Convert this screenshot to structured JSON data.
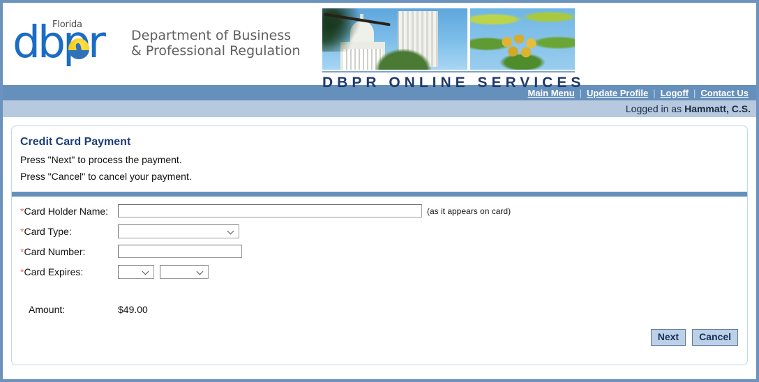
{
  "masthead": {
    "logo": {
      "florida": "Florida",
      "wordmark": "dbpr",
      "department": "Department of Business\n& Professional Regulation",
      "seal_icon": "florida-state-seal-icon"
    },
    "banner": {
      "photo_left": "florida-capitol-photo",
      "photo_right": "palm-tree-photo",
      "title": "DBPR ONLINE SERVICES"
    }
  },
  "nav": {
    "separator": "|",
    "links": [
      {
        "label": "Main Menu"
      },
      {
        "label": "Update Profile"
      },
      {
        "label": "Logoff"
      },
      {
        "label": "Contact Us"
      }
    ]
  },
  "status": {
    "logged_in_prefix": "Logged in as",
    "user": "Hammatt, C.S."
  },
  "card": {
    "title": "Credit Card Payment",
    "instruction_1": "Press \"Next\" to process the payment.",
    "instruction_2": "Press \"Cancel\" to cancel your payment."
  },
  "form": {
    "required_marker": "*",
    "fields": [
      {
        "label": "Card Holder Name:",
        "required": true,
        "type": "text",
        "value": "",
        "placeholder": "",
        "hint": "(as it appears on card)"
      },
      {
        "label": "Card Type:",
        "required": true,
        "type": "select",
        "value": ""
      },
      {
        "label": "Card Number:",
        "required": true,
        "type": "text",
        "value": "",
        "placeholder": ""
      },
      {
        "label": "Card Expires:",
        "required": true,
        "type": "select-pair",
        "month_value": "",
        "year_value": ""
      }
    ],
    "amount_label": "Amount:",
    "amount_value": "$49.00"
  },
  "buttons": {
    "next": "Next",
    "cancel": "Cancel"
  },
  "colors": {
    "frame": "#6b93bd",
    "nav_bar": "#6690bc",
    "status_bar": "#b6c9de",
    "divider": "#6690bc",
    "title_text": "#1c3d78",
    "banner_title": "#203a6b",
    "logo_blue": "#1b6cc4",
    "required_asterisk": "#e8705a",
    "button_face": "#bcd0e6",
    "button_text": "#16305e",
    "card_border": "#bcd9ef"
  }
}
